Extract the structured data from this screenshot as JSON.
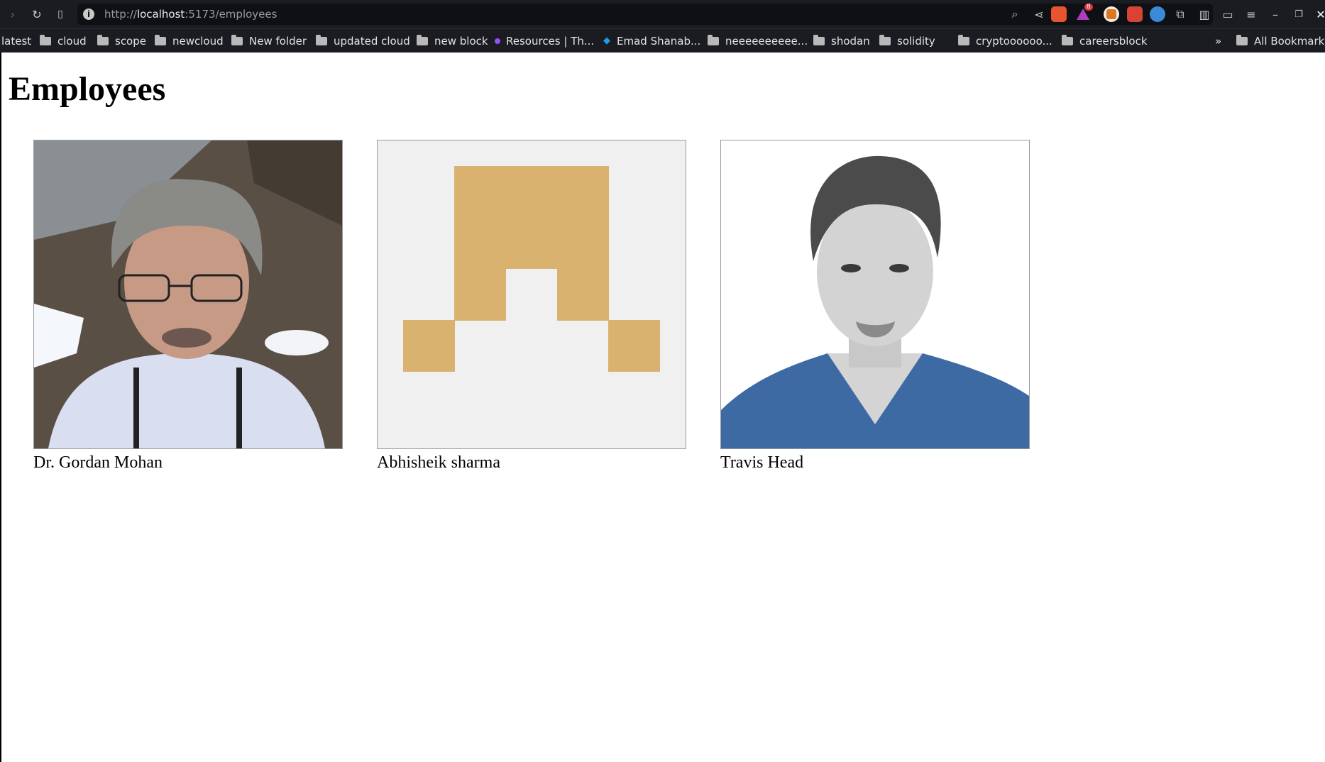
{
  "browser": {
    "url_scheme": "http://",
    "url_host": "localhost",
    "url_rest": ":5173/employees",
    "ext_badge": "8",
    "bookmarks": [
      {
        "label": "latest",
        "folder": false
      },
      {
        "label": "cloud",
        "folder": true
      },
      {
        "label": "scope",
        "folder": true
      },
      {
        "label": "newcloud",
        "folder": true
      },
      {
        "label": "New folder",
        "folder": true
      },
      {
        "label": "updated cloud",
        "folder": true
      },
      {
        "label": "new block",
        "folder": true
      },
      {
        "label": "Resources | Th...",
        "folder": false
      },
      {
        "label": "Emad Shanab...",
        "folder": false
      },
      {
        "label": "neeeeeeeeee...",
        "folder": true
      },
      {
        "label": "shodan",
        "folder": true
      },
      {
        "label": "solidity",
        "folder": true
      },
      {
        "label": "cryptoooooo...",
        "folder": true
      },
      {
        "label": "careersblock",
        "folder": true
      }
    ],
    "overflow": "»",
    "all_bookmarks": "All Bookmarks"
  },
  "page": {
    "title": "Employees"
  },
  "employees": [
    {
      "name": "Dr. Gordan Mohan",
      "photo": "photo-portrait"
    },
    {
      "name": "Abhisheik sharma",
      "photo": "identicon-placeholder"
    },
    {
      "name": "Travis Head",
      "photo": "photo-portrait"
    }
  ],
  "colors": {
    "identicon_bg": "#f0f0f0",
    "identicon_fg": "#d9b26f"
  }
}
